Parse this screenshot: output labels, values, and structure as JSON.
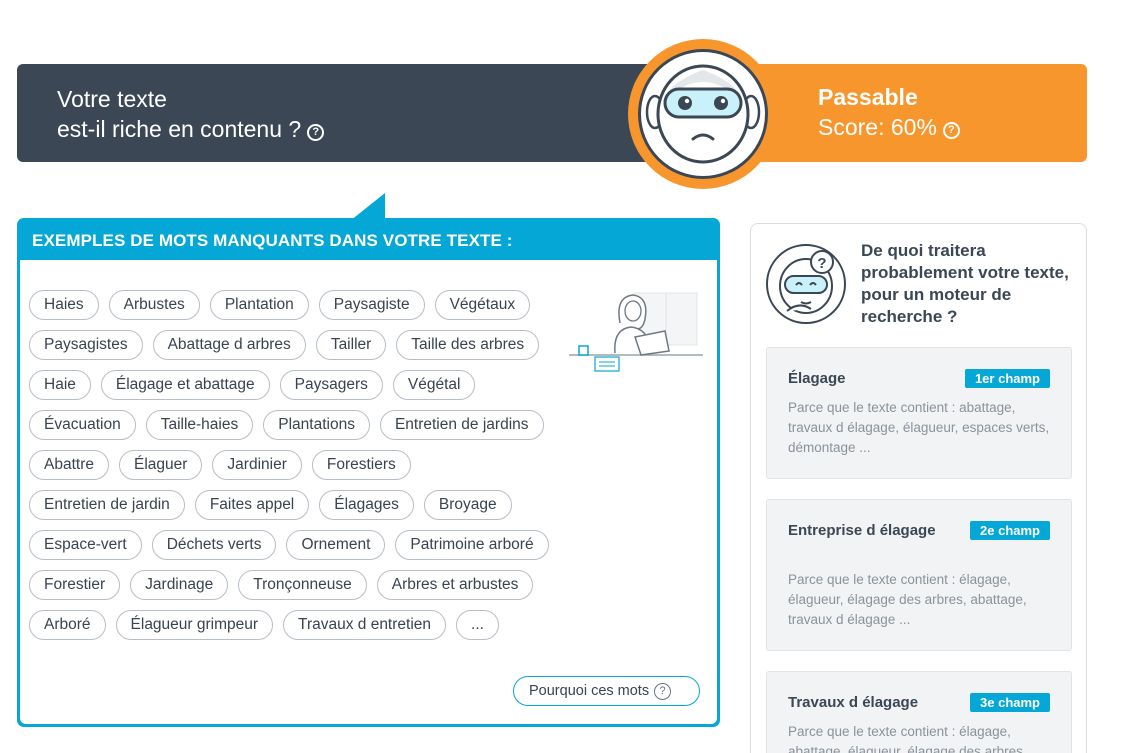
{
  "header": {
    "question_line1": "Votre texte",
    "question_line2": "est-il riche en contenu ?",
    "rating": "Passable",
    "score": "Score: 60%",
    "help_symbol": "?",
    "accent_color": "#f7962d",
    "dark_color": "#3b4754",
    "mascot_icon": "sad-robot-icon"
  },
  "missing_words": {
    "title": "EXEMPLES DE MOTS MANQUANTS DANS VOTRE TEXTE :",
    "accent_color": "#05a7d6",
    "words": [
      "Haies",
      "Arbustes",
      "Plantation",
      "Paysagiste",
      "Végétaux",
      "Paysagistes",
      "Abattage d arbres",
      "Tailler",
      "Taille des arbres",
      "Haie",
      "Élagage et abattage",
      "Paysagers",
      "Végétal",
      "Évacuation",
      "Taille-haies",
      "Plantations",
      "Entretien de jardins",
      "Abattre",
      "Élaguer",
      "Jardinier",
      "Forestiers",
      "Entretien de jardin",
      "Faites appel",
      "Élagages",
      "Broyage",
      "Espace-vert",
      "Déchets verts",
      "Ornement",
      "Patrimoine arboré",
      "Forestier",
      "Jardinage",
      "Tronçonneuse",
      "Arbres et arbustes",
      "Arboré",
      "Élagueur grimpeur",
      "Travaux d entretien",
      "..."
    ],
    "why_button": "Pourquoi ces mots",
    "why_help": "?",
    "illustration_icon": "woman-laptop-illustration"
  },
  "topics": {
    "question": "De quoi traitera probablement votre texte, pour un moteur de recherche ?",
    "avatar_icon": "thinking-robot-icon",
    "items": [
      {
        "name": "Élagage",
        "rank": "1er champ",
        "reason": "Parce que le texte contient :   abattage, travaux d élagage, élagueur, espaces verts, démontage ..."
      },
      {
        "name": "Entreprise d élagage",
        "rank": "2e champ",
        "reason": "Parce que le texte contient :   élagage, élagueur, élagage des arbres, abattage, travaux d élagage ..."
      },
      {
        "name": "Travaux d élagage",
        "rank": "3e champ",
        "reason": "Parce que le texte contient :   élagage, abattage, élagueur, élagage des arbres ..."
      }
    ]
  }
}
